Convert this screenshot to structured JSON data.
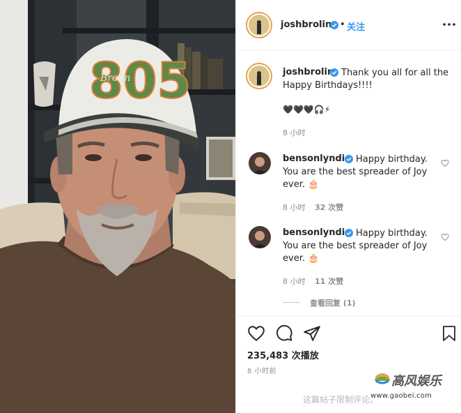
{
  "post": {
    "username": "joshbrolin",
    "follow_label": "关注"
  },
  "caption": {
    "username": "joshbrolin",
    "line1": "Thank you all for all the",
    "line2": "Happy Birthdays!!!!",
    "emoji_line": "🖤🖤🖤🎧⚡",
    "time": "8 小时"
  },
  "comments": [
    {
      "username": "bensonlyndie",
      "line1": "Happy birthday.",
      "line2": "You are the best spreader of Joy",
      "line3": "ever. 🎂",
      "time": "8 小时",
      "likes": "32 次赞"
    },
    {
      "username": "bensonlyndie",
      "line1": "Happy birthday.",
      "line2": "You are the best spreader of Joy",
      "line3": "ever. 🎂",
      "time": "8 小时",
      "likes": "11 次赞"
    }
  ],
  "view_replies": "查看回复 (1)",
  "stats": {
    "views": "235,483 次播放",
    "time_ago": "8 小时前"
  },
  "comments_disabled": "这篇帖子限制评论。",
  "watermark": {
    "title": "高风娱乐",
    "url": "www.gaobei.com"
  },
  "media": {
    "cap_text": "805",
    "cap_script": "Brolin"
  },
  "colors": {
    "link_blue": "#3897f0",
    "verified_blue": "#3897f0",
    "avatar_ring": "#e7a04b",
    "meta_gray": "#8e8e8e"
  },
  "icons": [
    "more-icon",
    "verified-icon",
    "heart-icon",
    "comment-icon",
    "share-icon",
    "bookmark-icon"
  ]
}
